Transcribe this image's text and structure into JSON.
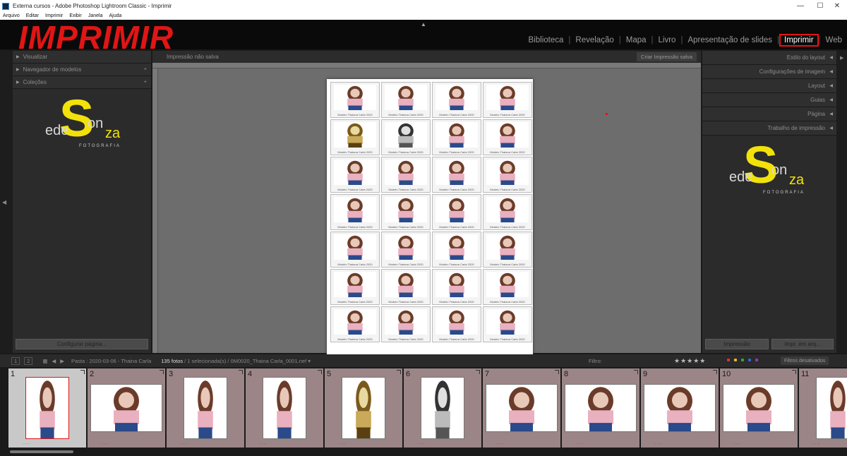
{
  "window": {
    "title": "Externa cursos - Adobe Photoshop Lightroom Classic - Imprimir",
    "controls": [
      "—",
      "☐",
      "✕"
    ]
  },
  "menu": [
    "Arquivo",
    "Editar",
    "Imprimir",
    "Exibir",
    "Janela",
    "Ajuda"
  ],
  "overlay_title": "IMPRIMIR",
  "modules": [
    {
      "label": "Biblioteca",
      "active": false
    },
    {
      "label": "Revelação",
      "active": false
    },
    {
      "label": "Mapa",
      "active": false
    },
    {
      "label": "Livro",
      "active": false
    },
    {
      "label": "Apresentação de slides",
      "active": false
    },
    {
      "label": "Imprimir",
      "active": true
    },
    {
      "label": "Web",
      "active": false
    }
  ],
  "left_panel": {
    "sections": [
      "Visualizar",
      "Navegador de modelos",
      "Coleções"
    ],
    "bottom_button": "Configurar página..."
  },
  "logo": {
    "ede": "ede",
    "s": "S",
    "on": "on",
    "za": "za",
    "foto": "FOTOGRAFIA"
  },
  "center": {
    "status": "Impressão não salva",
    "save_button": "Criar Impressão salva",
    "caption": "Modelo Thaiana Carla 2020"
  },
  "right_panel": {
    "sections": [
      "Estilo do layout",
      "Configurações de imagem",
      "Layout",
      "Guias",
      "Página",
      "Trabalho de impressão"
    ],
    "print_button": "Impressão",
    "print_file_button": "Impr. em arq..."
  },
  "filmstrip_bar": {
    "page_buttons": [
      "1",
      "2"
    ],
    "source": "Pasta : 2020-03-06 - Thaina Carla",
    "count": "135 fotos",
    "selection": "/ 1 selecionada(s) / 0M0020_Thaina Carla_0001.nef ▾",
    "filter_label": "Filtro:",
    "stars": "★★★★★",
    "filters_off": "Filtros desativados"
  },
  "filmstrip": [
    {
      "n": "1",
      "sel": true,
      "orient": "portrait",
      "tone": "color"
    },
    {
      "n": "2",
      "sel": false,
      "orient": "landscape",
      "tone": "color"
    },
    {
      "n": "3",
      "sel": false,
      "orient": "portrait",
      "tone": "color"
    },
    {
      "n": "4",
      "sel": false,
      "orient": "portrait",
      "tone": "color"
    },
    {
      "n": "5",
      "sel": false,
      "orient": "portrait",
      "tone": "sepia"
    },
    {
      "n": "6",
      "sel": false,
      "orient": "portrait",
      "tone": "bw"
    },
    {
      "n": "7",
      "sel": false,
      "orient": "landscape",
      "tone": "color"
    },
    {
      "n": "8",
      "sel": false,
      "orient": "landscape",
      "tone": "color"
    },
    {
      "n": "9",
      "sel": false,
      "orient": "landscape",
      "tone": "color"
    },
    {
      "n": "10",
      "sel": false,
      "orient": "landscape",
      "tone": "color"
    },
    {
      "n": "11",
      "sel": false,
      "orient": "portrait",
      "tone": "color"
    }
  ],
  "contact_sheet": [
    "color",
    "color",
    "color",
    "color",
    "sepia",
    "bw",
    "color",
    "color",
    "color",
    "color",
    "color",
    "color",
    "color",
    "color",
    "color",
    "color",
    "color",
    "color",
    "color",
    "color",
    "color",
    "color",
    "color",
    "color",
    "color",
    "color",
    "color",
    "color"
  ],
  "colors": {
    "accent_red": "#e21515",
    "logo_yellow": "#f2e20a",
    "filmstrip_bg": "#9b8587"
  }
}
